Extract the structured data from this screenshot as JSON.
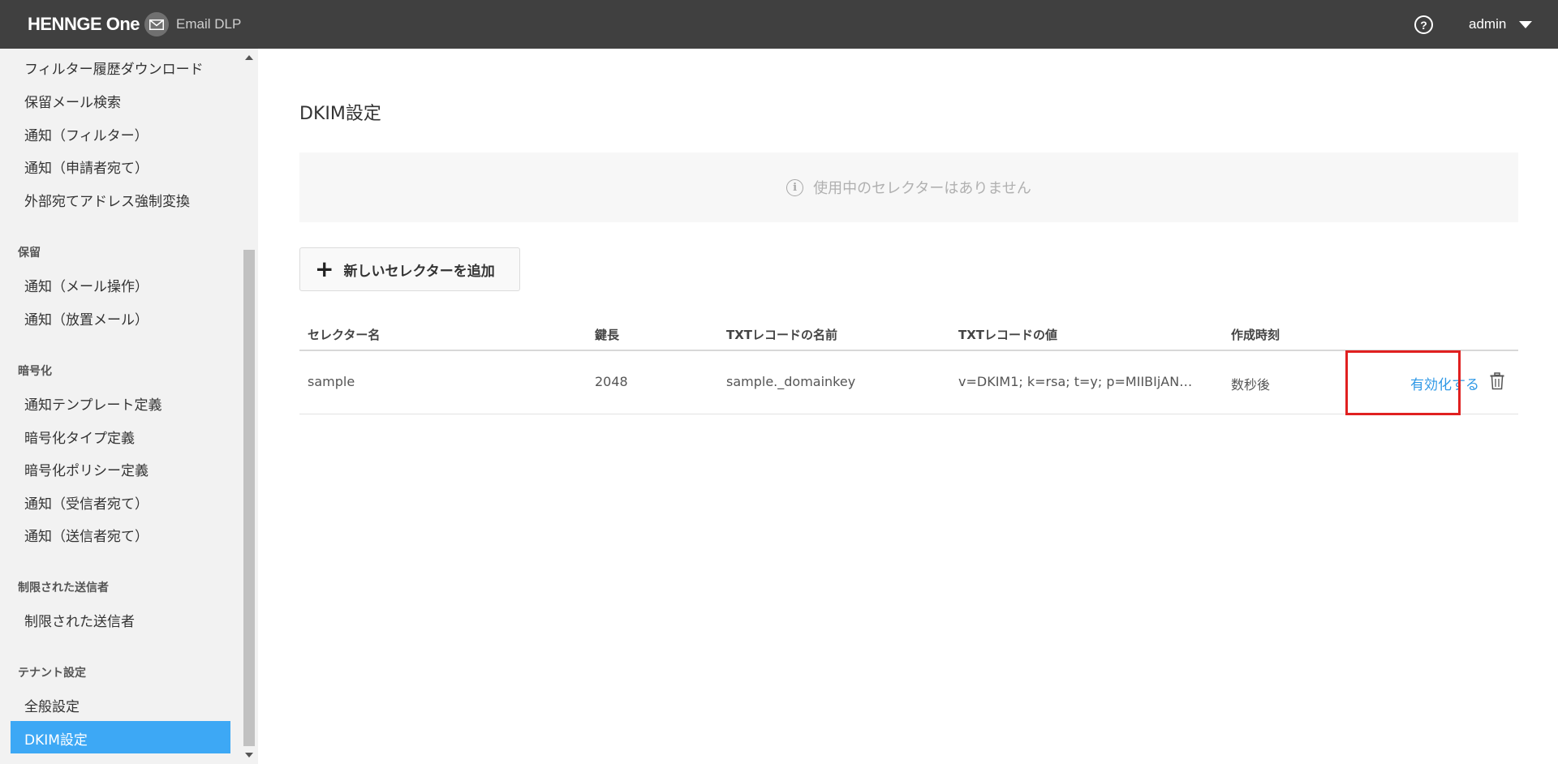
{
  "header": {
    "brand": "HENNGE One",
    "product": "Email DLP",
    "help_icon": "?",
    "user": "admin"
  },
  "sidebar": {
    "items_top": [
      "フィルター履歴ダウンロード",
      "保留メール検索",
      "通知（フィルター）",
      "通知（申請者宛て）",
      "外部宛てアドレス強制変換"
    ],
    "section_hold": "保留",
    "items_hold": [
      "通知（メール操作）",
      "通知（放置メール）"
    ],
    "section_encrypt": "暗号化",
    "items_encrypt": [
      "通知テンプレート定義",
      "暗号化タイプ定義",
      "暗号化ポリシー定義",
      "通知（受信者宛て）",
      "通知（送信者宛て）"
    ],
    "section_restricted": "制限された送信者",
    "items_restricted": [
      "制限された送信者"
    ],
    "section_tenant": "テナント設定",
    "items_tenant": [
      "全般設定",
      "DKIM設定"
    ]
  },
  "main": {
    "title": "DKIM設定",
    "notice": "使用中のセレクターはありません",
    "add_button": "新しいセレクターを追加",
    "table": {
      "headers": [
        "セレクター名",
        "鍵長",
        "TXTレコードの名前",
        "TXTレコードの値",
        "作成時刻"
      ],
      "rows": [
        {
          "selector": "sample",
          "key_length": "2048",
          "txt_name": "sample._domainkey",
          "txt_value": "v=DKIM1; k=rsa; t=y; p=MIIBIjAN…",
          "created": "数秒後",
          "action": "有効化する"
        }
      ]
    }
  },
  "colors": {
    "topbar": "#404040",
    "active_nav": "#3da8f5",
    "link": "#2e98e6",
    "highlight": "#e02020"
  }
}
